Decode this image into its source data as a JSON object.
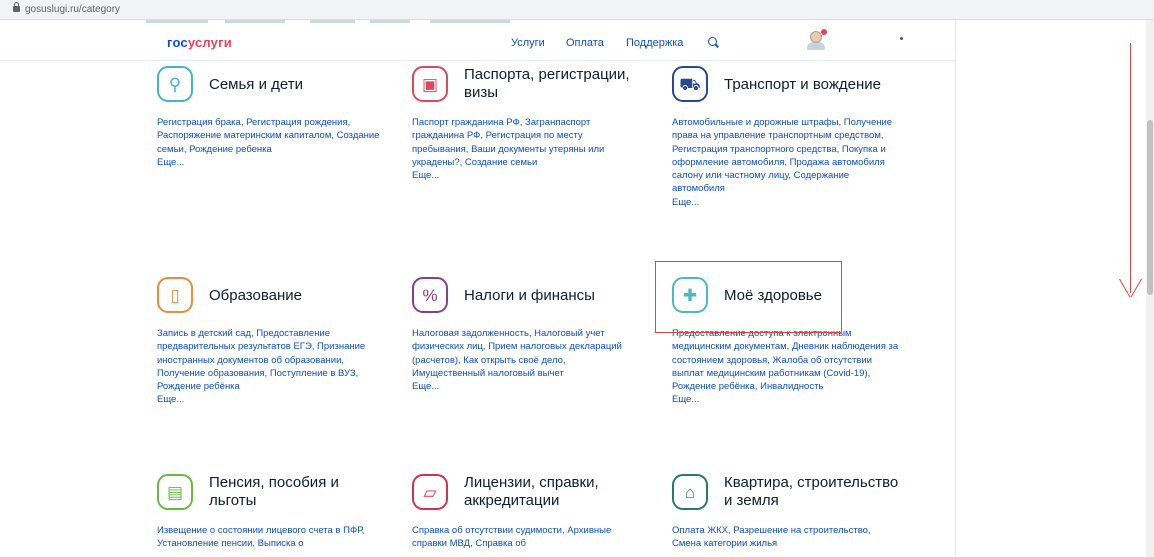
{
  "browser": {
    "url": "gosuslugi.ru/category"
  },
  "header": {
    "logo_part1": "гос",
    "logo_part2": "услуги",
    "nav": [
      "Услуги",
      "Оплата",
      "Поддержка"
    ]
  },
  "colors": {
    "brand_blue": "#0d4cd3",
    "brand_red": "#ee3f58",
    "annotation_red": "#e04545"
  },
  "categories": [
    {
      "title": "Семья и дети",
      "icon": "stroller-icon",
      "glyph": "⚲",
      "color": "#43b4c9",
      "description": "Регистрация брака, Регистрация рождения, Распоряжение материнским капиталом, Создание семьи, Рождение ребенка",
      "more": "Еще..."
    },
    {
      "title": "Паспорта, регистрации, визы",
      "icon": "passport-icon",
      "glyph": "▣",
      "color": "#e0475e",
      "description": "Паспорт гражданина РФ, Загранпаспорт гражданина РФ, Регистрация по месту пребывания, Ваши документы утеряны или украдены?, Создание семьи",
      "more": "Еще..."
    },
    {
      "title": "Транспорт и вождение",
      "icon": "car-icon",
      "glyph": "⛟",
      "color": "#2a4a8c",
      "description": "Автомобильные и дорожные штрафы, Получение права на управление транспортным средством, Регистрация транспортного средства, Покупка и оформление автомобиля, Продажа автомобиля салону или частному лицу, Содержание автомобиля",
      "more": "Еще..."
    },
    {
      "title": "Образование",
      "icon": "book-icon",
      "glyph": "▯",
      "color": "#f08a3a",
      "description": "Запись в детский сад, Предоставление предварительных результатов ЕГЭ, Признание иностранных документов об образовании, Получение образования, Поступление в ВУЗ, Рождение ребёнка",
      "more": "Еще..."
    },
    {
      "title": "Налоги и финансы",
      "icon": "tax-document-icon",
      "glyph": "%",
      "color": "#8a3e8f",
      "description": "Налоговая задолженность, Налоговый учет физических лиц, Прием налоговых деклараций (расчетов), Как открыть своё дело, Имущественный налоговый вычет",
      "more": "Еще..."
    },
    {
      "title": "Моё здоровье",
      "icon": "medical-cross-icon",
      "glyph": "✚",
      "color": "#4bb8c6",
      "description": "Предоставление доступа к электронным медицинским документам, Дневник наблюдения за состоянием здоровья, Жалоба об отсутствии выплат медицинским работникам (Covid-19), Рождение ребёнка, Инвалидность",
      "more": "Еще..."
    },
    {
      "title": "Пенсия, пособия и льготы",
      "icon": "wallet-icon",
      "glyph": "▤",
      "color": "#6bb83f",
      "description": "Извещение о состоянии лицевого счета в ПФР, Установление пенсии, Выписка о",
      "more": ""
    },
    {
      "title": "Лицензии, справки, аккредитации",
      "icon": "folder-icon",
      "glyph": "▱",
      "color": "#d2334c",
      "description": "Справка об отсутствии судимости, Архивные справки МВД, Справка об",
      "more": ""
    },
    {
      "title": "Квартира, строительство и земля",
      "icon": "house-icon",
      "glyph": "⌂",
      "color": "#2a7a6a",
      "description": "Оплата ЖКХ, Разрешение на строительство, Смена категории жилья",
      "more": ""
    }
  ]
}
